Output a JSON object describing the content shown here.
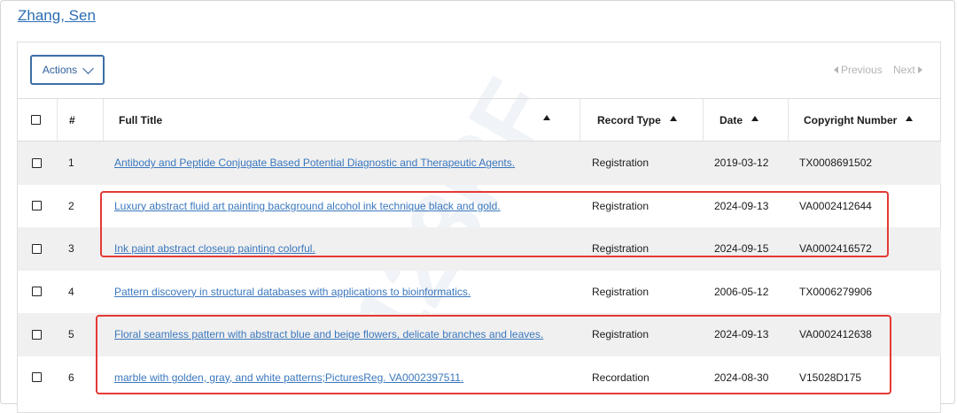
{
  "author": "Zhang, Sen",
  "toolbar": {
    "actions_label": "Actions",
    "previous_label": "Previous",
    "next_label": "Next"
  },
  "columns": {
    "index": "#",
    "full_title": "Full Title",
    "record_type": "Record Type",
    "date": "Date",
    "copyright_number": "Copyright Number"
  },
  "rows": [
    {
      "index": "1",
      "title": "Antibody and Peptide Conjugate Based Potential Diagnostic and Therapeutic Agents.",
      "record_type": "Registration",
      "date": "2019-03-12",
      "number": "TX0008691502"
    },
    {
      "index": "2",
      "title": "Luxury abstract fluid art painting background alcohol ink technique black and gold.",
      "record_type": "Registration",
      "date": "2024-09-13",
      "number": "VA0002412644"
    },
    {
      "index": "3",
      "title": "Ink paint abstract closeup painting colorful.",
      "record_type": "Registration",
      "date": "2024-09-15",
      "number": "VA0002416572"
    },
    {
      "index": "4",
      "title": "Pattern discovery in structural databases with applications to bioinformatics.",
      "record_type": "Registration",
      "date": "2006-05-12",
      "number": "TX0006279906"
    },
    {
      "index": "5",
      "title": "Floral seamless pattern with abstract blue and beige flowers, delicate branches and leaves.",
      "record_type": "Registration",
      "date": "2024-09-13",
      "number": "VA0002412638"
    },
    {
      "index": "6",
      "title": "marble with golden, gray, and white patterns;PicturesReg. VA0002397511.",
      "record_type": "Recordation",
      "date": "2024-08-30",
      "number": "V15028D175"
    }
  ],
  "watermark": "123RF",
  "colors": {
    "link": "#3a77bd",
    "highlight_box": "#e53935",
    "button_border": "#3d6ea8"
  }
}
